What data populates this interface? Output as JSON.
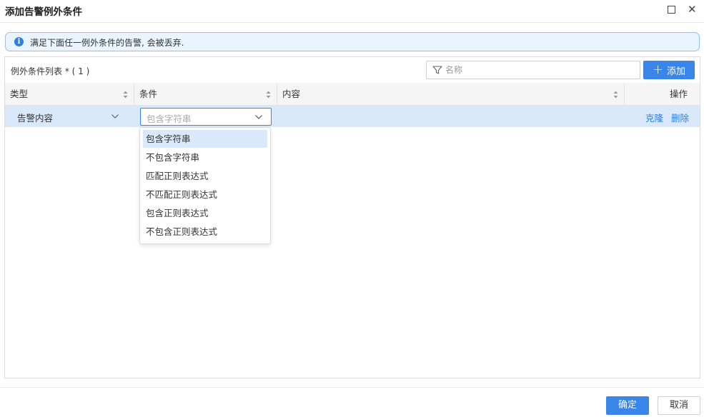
{
  "dialog": {
    "title": "添加告警例外条件"
  },
  "info": {
    "text": "满足下面任一例外条件的告警, 会被丢弃.",
    "icon": "info-icon"
  },
  "list": {
    "title": "例外条件列表 * ( 1 )",
    "filter_placeholder": "名称",
    "add_label": "添加",
    "columns": {
      "type": "类型",
      "condition": "条件",
      "content": "内容",
      "actions": "操作"
    },
    "rows": [
      {
        "type": "告警内容",
        "condition_placeholder": "包含字符串",
        "content": "",
        "clone_label": "克隆",
        "delete_label": "删除"
      }
    ]
  },
  "condition_dropdown": {
    "options": [
      "包含字符串",
      "不包含字符串",
      "匹配正则表达式",
      "不匹配正则表达式",
      "包含正则表达式",
      "不包含正则表达式"
    ],
    "highlighted": "包含字符串"
  },
  "footer": {
    "ok_label": "确定",
    "cancel_label": "取消"
  },
  "colors": {
    "accent": "#3a85e8",
    "info_bg": "#eaf4fe",
    "row_selected": "#d9e8fa"
  }
}
